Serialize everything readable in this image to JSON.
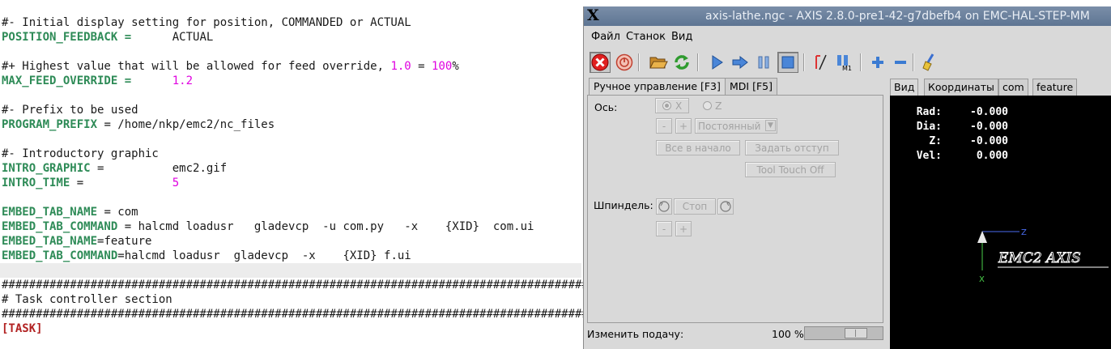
{
  "editor": {
    "lines": [
      {
        "parts": [
          {
            "t": "#- Initial display setting for position, COMMANDED or ACTUAL",
            "c": ""
          }
        ]
      },
      {
        "parts": [
          {
            "t": "POSITION_FEEDBACK =",
            "c": "k"
          },
          {
            "t": "      ACTUAL",
            "c": ""
          }
        ]
      },
      {
        "parts": []
      },
      {
        "parts": [
          {
            "t": "#+ Highest value that will be allowed for feed override, ",
            "c": ""
          },
          {
            "t": "1.0",
            "c": "n"
          },
          {
            "t": " = ",
            "c": ""
          },
          {
            "t": "100",
            "c": "n"
          },
          {
            "t": "%",
            "c": ""
          }
        ]
      },
      {
        "parts": [
          {
            "t": "MAX_FEED_OVERRIDE =",
            "c": "k"
          },
          {
            "t": "      ",
            "c": ""
          },
          {
            "t": "1.2",
            "c": "n"
          }
        ]
      },
      {
        "parts": []
      },
      {
        "parts": [
          {
            "t": "#- Prefix to be used",
            "c": ""
          }
        ]
      },
      {
        "parts": [
          {
            "t": "PROGRAM_PREFIX",
            "c": "k"
          },
          {
            "t": " = /home/nkp/emc2/nc_files",
            "c": ""
          }
        ]
      },
      {
        "parts": []
      },
      {
        "parts": [
          {
            "t": "#- Introductory graphic",
            "c": ""
          }
        ]
      },
      {
        "parts": [
          {
            "t": "INTRO_GRAPHIC",
            "c": "k"
          },
          {
            "t": " =          emc2.gif",
            "c": ""
          }
        ]
      },
      {
        "parts": [
          {
            "t": "INTRO_TIME",
            "c": "k"
          },
          {
            "t": " =             ",
            "c": ""
          },
          {
            "t": "5",
            "c": "n"
          }
        ]
      },
      {
        "parts": []
      },
      {
        "parts": [
          {
            "t": "EMBED_TAB_NAME",
            "c": "k"
          },
          {
            "t": " = com",
            "c": ""
          }
        ]
      },
      {
        "parts": [
          {
            "t": "EMBED_TAB_COMMAND",
            "c": "k"
          },
          {
            "t": " = halcmd loadusr   gladevcp  -u com.py   -x    {XID}  com.ui",
            "c": ""
          }
        ]
      },
      {
        "parts": [
          {
            "t": "EMBED_TAB_NAME",
            "c": "k"
          },
          {
            "t": "=feature",
            "c": ""
          }
        ]
      },
      {
        "parts": [
          {
            "t": "EMBED_TAB_COMMAND",
            "c": "k"
          },
          {
            "t": "=halcmd loadusr  gladevcp  -x    {XID} f.ui",
            "c": ""
          }
        ]
      },
      {
        "parts": [],
        "hl": true
      },
      {
        "parts": [
          {
            "t": "####################################################################################################",
            "c": ""
          }
        ]
      },
      {
        "parts": [
          {
            "t": "# Task controller section",
            "c": ""
          }
        ]
      },
      {
        "parts": [
          {
            "t": "####################################################################################################",
            "c": ""
          }
        ]
      },
      {
        "parts": [
          {
            "t": "[TASK]",
            "c": "s"
          }
        ]
      }
    ]
  },
  "axis": {
    "title": "axis-lathe.ngc - AXIS 2.8.0-pre1-42-g7dbefb4 on EMC-HAL-STEP-MM",
    "title_icon": "X",
    "menu": [
      "Файл",
      "Станок",
      "Вид"
    ],
    "tabs_left": [
      "Ручное управление [F3]",
      "MDI [F5]"
    ],
    "tabs_right": [
      "Вид",
      "Координаты",
      "com",
      "feature"
    ],
    "manual": {
      "axis_label": "Ось:",
      "axis_x": "X",
      "axis_z": "Z",
      "minus": "-",
      "plus": "+",
      "jog_mode": "Постоянный",
      "home_all": "Все в начало",
      "touch_off": "Задать отступ",
      "tool_touch_off": "Tool Touch Off",
      "spindle_label": "Шпиндель:",
      "spindle_stop": "Стоп"
    },
    "feed": {
      "label": "Изменить подачу:",
      "value": "100 %",
      "position": 0.72
    },
    "dro": [
      {
        "label": "Rad:",
        "value": "-0.000"
      },
      {
        "label": "Dia:",
        "value": "-0.000"
      },
      {
        "label": "Z:",
        "value": "-0.000"
      },
      {
        "label": "Vel:",
        "value": "0.000"
      }
    ],
    "preview_axis_z": "Z",
    "preview_axis_x": "X",
    "logo_text": "EMC2 AXIS",
    "colors": {
      "titlebar": "#6a81a0",
      "keyword": "#2e8b57",
      "number": "#e000e0",
      "section": "#b22222"
    }
  }
}
